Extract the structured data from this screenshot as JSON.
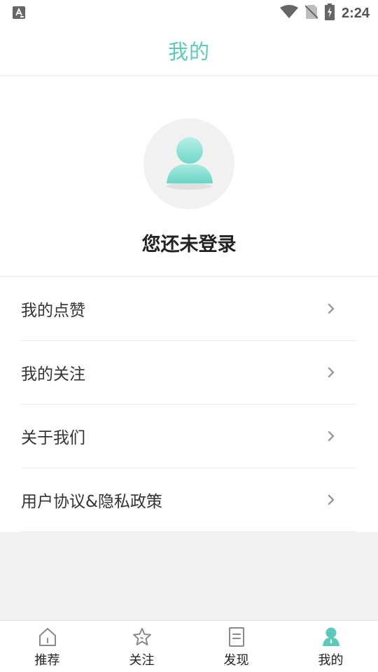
{
  "status_bar": {
    "time": "2:24",
    "icons": [
      "font-a-icon",
      "wifi-icon",
      "no-sim-icon",
      "battery-charging-icon"
    ]
  },
  "header": {
    "title": "我的"
  },
  "profile": {
    "avatar_icon": "user-avatar-icon",
    "login_status": "您还未登录"
  },
  "menu": {
    "items": [
      {
        "label": "我的点赞",
        "icon": "chevron-right-icon"
      },
      {
        "label": "我的关注",
        "icon": "chevron-right-icon"
      },
      {
        "label": "关于我们",
        "icon": "chevron-right-icon"
      },
      {
        "label": "用户协议&隐私政策",
        "icon": "chevron-right-icon"
      }
    ]
  },
  "bottom_nav": {
    "items": [
      {
        "label": "推荐",
        "icon": "home-icon",
        "active": false
      },
      {
        "label": "关注",
        "icon": "star-icon",
        "active": false
      },
      {
        "label": "发现",
        "icon": "document-icon",
        "active": false
      },
      {
        "label": "我的",
        "icon": "person-icon",
        "active": true
      }
    ]
  },
  "colors": {
    "accent": "#5cc9bb",
    "background": "#f2f2f2",
    "text_primary": "#222222",
    "icon_inactive": "#8a8a8a"
  }
}
